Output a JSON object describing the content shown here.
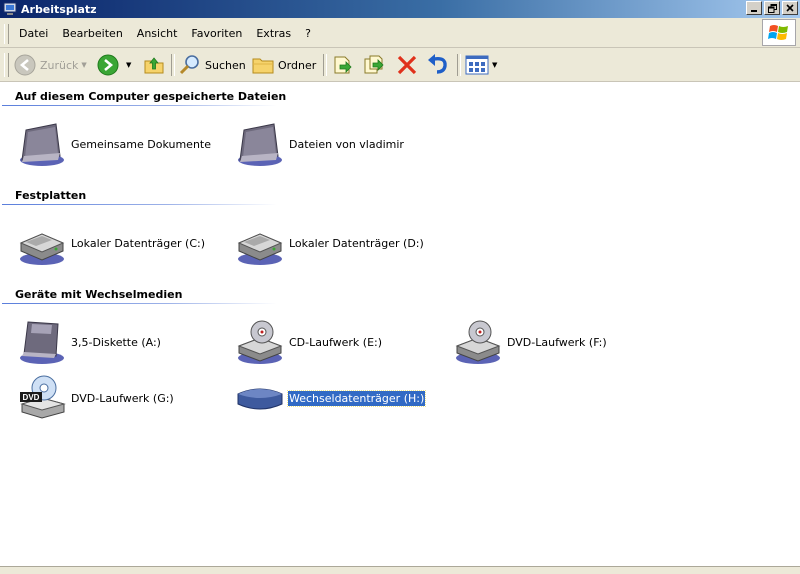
{
  "window": {
    "title": "Arbeitsplatz",
    "accent_color": "#0a246a"
  },
  "menu": {
    "items": [
      "Datei",
      "Bearbeiten",
      "Ansicht",
      "Favoriten",
      "Extras",
      "?"
    ]
  },
  "toolbar": {
    "back_label": "Zurück",
    "search_label": "Suchen",
    "folders_label": "Ordner"
  },
  "groups": [
    {
      "title": "Auf diesem Computer gespeicherte Dateien",
      "items": [
        {
          "label": "Gemeinsame Dokumente",
          "icon": "shared-folder-icon"
        },
        {
          "label": "Dateien von vladimir",
          "icon": "user-folder-icon"
        }
      ]
    },
    {
      "title": "Festplatten",
      "items": [
        {
          "label": "Lokaler Datenträger (C:)",
          "icon": "hard-drive-icon"
        },
        {
          "label": "Lokaler Datenträger (D:)",
          "icon": "hard-drive-icon"
        }
      ]
    },
    {
      "title": "Geräte mit Wechselmedien",
      "items": [
        {
          "label": "3,5-Diskette (A:)",
          "icon": "floppy-drive-icon"
        },
        {
          "label": "CD-Laufwerk (E:)",
          "icon": "cd-drive-icon"
        },
        {
          "label": "DVD-Laufwerk (F:)",
          "icon": "cd-drive-icon"
        },
        {
          "label": "DVD-Laufwerk (G:)",
          "icon": "dvd-drive-icon",
          "badge": "DVD"
        },
        {
          "label": "Wechseldatenträger (H:)",
          "icon": "removable-drive-icon",
          "selected": true
        }
      ]
    }
  ]
}
